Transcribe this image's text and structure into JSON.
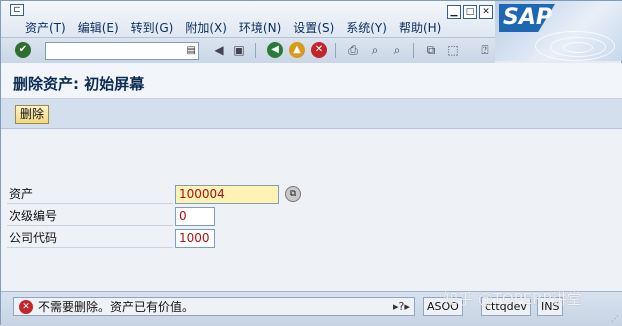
{
  "menu": {
    "items": [
      "资产(T)",
      "编辑(E)",
      "转到(G)",
      "附加(X)",
      "环境(N)",
      "设置(S)",
      "系统(Y)",
      "帮助(H)"
    ]
  },
  "logo": {
    "text": "SAP"
  },
  "toolbar": {
    "command_value": "",
    "icons": [
      "enter-icon",
      "back-nav-icon",
      "save-icon",
      "back-icon",
      "exit-icon",
      "cancel-icon",
      "print-icon",
      "find-icon",
      "find-next-icon",
      "create-session-icon",
      "shortcut-icon",
      "help-icon"
    ]
  },
  "screen": {
    "title": "删除资产: 初始屏幕"
  },
  "app_toolbar": {
    "delete_label": "删除"
  },
  "fields": [
    {
      "label": "资产",
      "value": "100004"
    },
    {
      "label": "次级编号",
      "value": "0"
    },
    {
      "label": "公司代码",
      "value": "1000"
    }
  ],
  "status": {
    "message": "不需要删除。资产已有价值。",
    "system": "ASOO",
    "server": "cttqdev",
    "mode": "INS"
  },
  "watermark": "知乎 @TOPERP讲堂",
  "colors": {
    "accent": "#0b2d55",
    "error": "#c0262b",
    "button": "#f1d880",
    "value_text": "#a11111"
  }
}
